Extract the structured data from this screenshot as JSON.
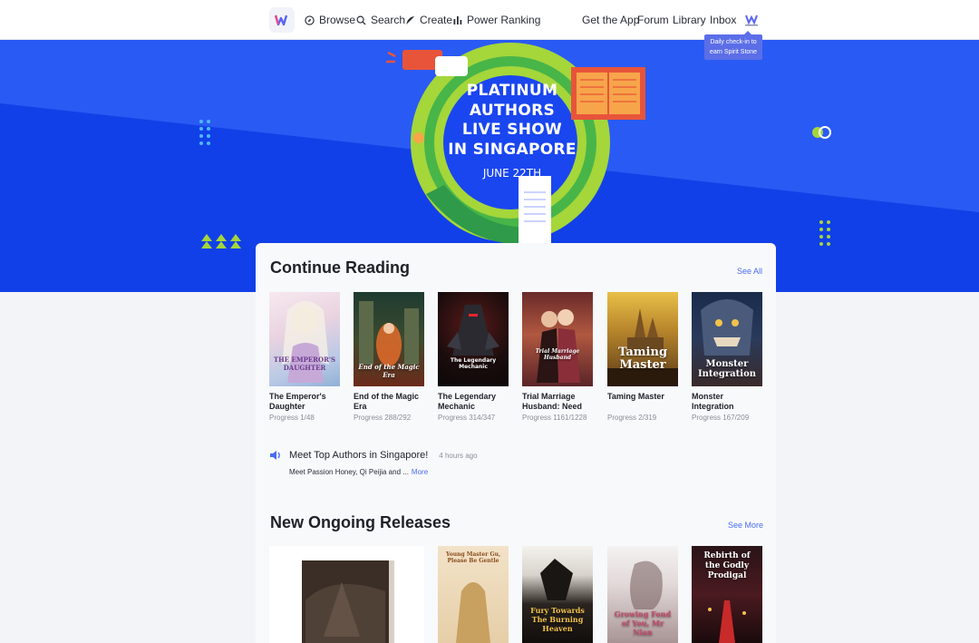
{
  "nav": {
    "items": [
      {
        "label": "Browse",
        "icon": "compass-icon"
      },
      {
        "label": "Search",
        "icon": "search-icon"
      },
      {
        "label": "Create",
        "icon": "quill-icon"
      },
      {
        "label": "Power Ranking",
        "icon": "bar-chart-icon"
      }
    ],
    "right": [
      "Get the App",
      "Forum",
      "Library",
      "Inbox"
    ],
    "tooltip": "Daily check-in to earn Spirit Stone"
  },
  "hero": {
    "title_lines": [
      "PLATINUM",
      "AUTHORS",
      "LIVE SHOW",
      "IN SINGAPORE"
    ],
    "date": "JUNE 22TH",
    "colors": {
      "bg": "#1a46f0",
      "green": "#a5d63a",
      "red": "#e8543a"
    }
  },
  "continue_reading": {
    "title": "Continue Reading",
    "see_all": "See All",
    "books": [
      {
        "title": "The Emperor's Daughter",
        "progress": "Progress 1/48",
        "cover_text": "THE EMPEROR'S DAUGHTER",
        "dot": false
      },
      {
        "title": "End of the Magic Era",
        "progress": "Progress 288/292",
        "cover_text": "End of the Magic Era",
        "dot": true
      },
      {
        "title": "The Legendary Mechanic",
        "progress": "Progress 314/347",
        "cover_text": "The Legendary Mechanic",
        "dot": true
      },
      {
        "title": "Trial Marriage Husband: Need t...",
        "progress": "Progress 1161/1228",
        "cover_text": "Trial Marriage Husband",
        "dot": true
      },
      {
        "title": "Taming Master",
        "progress": "Progress 2/319",
        "cover_text": "Taming Master",
        "dot": false
      },
      {
        "title": "Monster Integration",
        "progress": "Progress 167/209",
        "cover_text": "Monster Integration",
        "dot": true
      }
    ]
  },
  "news": {
    "title": "Meet Top Authors in Singapore!",
    "time": "4 hours ago",
    "summary": "Meet Passion Honey, Qi Peijia and ...",
    "more": "More"
  },
  "new_releases": {
    "title": "New Ongoing Releases",
    "see_more": "See More",
    "covers": [
      {
        "cover_text": "Young Master Gu, Please Be Gentle"
      },
      {
        "cover_text": "Fury Towards The Burning Heaven"
      },
      {
        "cover_text": "Growing Fond of You, Mr Nian"
      },
      {
        "cover_text": "Rebirth of the Godly Prodigal"
      }
    ]
  }
}
